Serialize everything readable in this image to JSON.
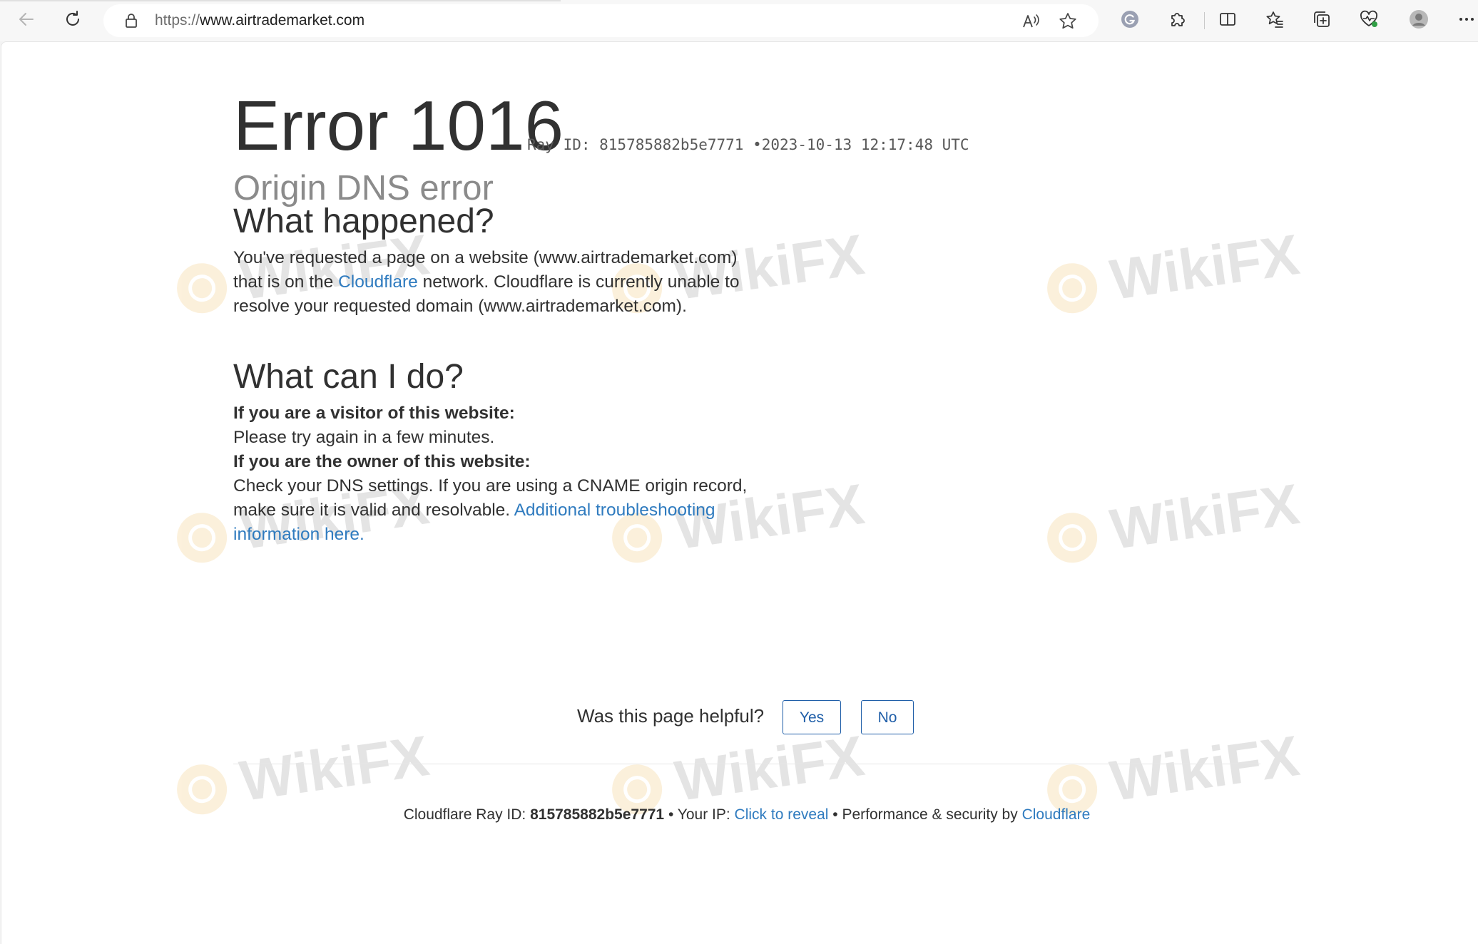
{
  "browser": {
    "url_scheme": "https://",
    "url_host": "www.airtrademarket.com",
    "icons": {
      "back": "back-arrow-icon",
      "refresh": "refresh-icon",
      "lock": "lock-icon",
      "read_aloud": "read-aloud-icon",
      "favorite": "star-icon",
      "grammarly": "grammarly-icon",
      "extensions": "puzzle-icon",
      "split_screen": "split-screen-icon",
      "favorites": "favorites-list-icon",
      "collections": "collections-icon",
      "performance": "heartbeat-icon",
      "profile": "avatar-icon",
      "more": "more-icon"
    }
  },
  "error": {
    "title": "Error 1016",
    "ray_id_label": "Ray ID: 815785882b5e7771",
    "separator": "•",
    "timestamp": "2023-10-13 12:17:48 UTC",
    "subtitle": "Origin DNS error"
  },
  "what_happened": {
    "heading": "What happened?",
    "text_1": "You've requested a page on a website (www.airtrademarket.com) that is on the ",
    "link": "Cloudflare",
    "text_2": " network. Cloudflare is currently unable to resolve your requested domain (www.airtrademarket.com)."
  },
  "what_can_i_do": {
    "heading": "What can I do?",
    "visitor_label": "If you are a visitor of this website:",
    "visitor_text": "Please try again in a few minutes.",
    "owner_label": "If you are the owner of this website:",
    "owner_text": "Check your DNS settings. If you are using a CNAME origin record, make sure it is valid and resolvable. ",
    "owner_link": "Additional troubleshooting information here."
  },
  "feedback": {
    "question": "Was this page helpful?",
    "yes": "Yes",
    "no": "No"
  },
  "footer": {
    "ray_label": "Cloudflare Ray ID: ",
    "ray_value": "815785882b5e7771",
    "sep1": " • ",
    "ip_label": "Your IP: ",
    "ip_link": "Click to reveal",
    "sep2": " • ",
    "perf_label": "Performance & security by ",
    "perf_link": "Cloudflare"
  },
  "watermark": {
    "text": "WikiFX"
  },
  "colors": {
    "link": "#2f7bbf",
    "button": "#1f5ea8",
    "text": "#313131",
    "subtitle": "#8b8b8b"
  }
}
